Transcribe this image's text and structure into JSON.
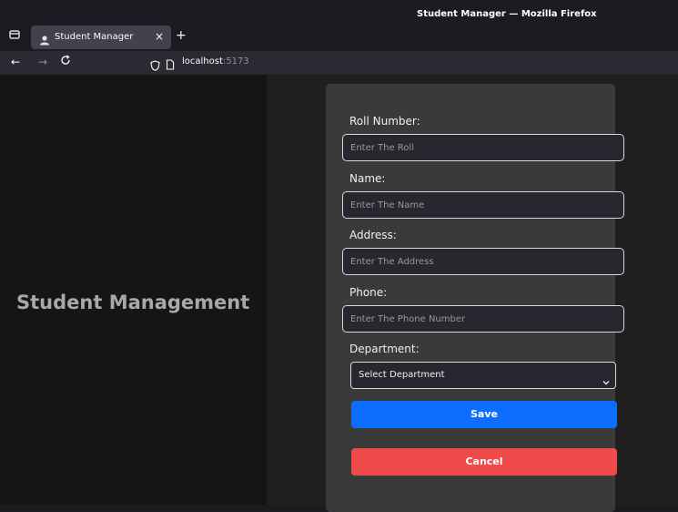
{
  "window": {
    "title": "Student Manager — Mozilla Firefox"
  },
  "tab": {
    "title": "Student Manager",
    "close_glyph": "×",
    "new_tab_glyph": "+"
  },
  "nav": {
    "back_glyph": "←",
    "forward_glyph": "→",
    "reload_glyph": "C",
    "url_host": "localhost",
    "url_port": ":5173"
  },
  "page": {
    "heading": "Student Management",
    "form": {
      "roll": {
        "label": "Roll Number:",
        "placeholder": "Enter The Roll",
        "value": ""
      },
      "name": {
        "label": "Name:",
        "placeholder": "Enter The Name",
        "value": ""
      },
      "address": {
        "label": "Address:",
        "placeholder": "Enter The Address",
        "value": ""
      },
      "phone": {
        "label": "Phone:",
        "placeholder": "Enter The Phone Number",
        "value": ""
      },
      "department": {
        "label": "Department:",
        "selected": "Select Department"
      },
      "save_label": "Save",
      "cancel_label": "Cancel"
    }
  },
  "icons": {
    "tab_list": "tab-list-icon",
    "favicon": "person-icon",
    "shield": "shield-icon",
    "page": "page-icon",
    "chevron": "chevron-down-icon"
  },
  "colors": {
    "save": "#0d6efd",
    "cancel": "#ef4b4b",
    "card": "#3a3a3a"
  }
}
